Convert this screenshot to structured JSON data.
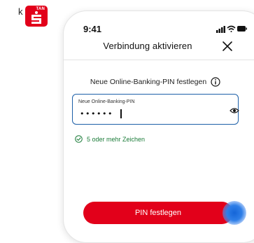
{
  "app_badge": {
    "text": "TAN",
    "icon": "sparkasse-s-logo"
  },
  "left_char": "k",
  "status_bar": {
    "time": "9:41",
    "icons": [
      "signal-icon",
      "wifi-icon",
      "battery-icon"
    ]
  },
  "header": {
    "title": "Verbindung aktivieren",
    "close_icon": "close-icon"
  },
  "prompt": {
    "text": "Neue Online-Banking-PIN festlegen",
    "info_icon": "info-icon"
  },
  "pin_field": {
    "label": "Neue Online-Banking-PIN",
    "value": "••••••",
    "toggle_icon": "eye-icon"
  },
  "validation": {
    "text": "5 oder mehr Zeichen",
    "icon": "check-circle-icon"
  },
  "primary_button": {
    "label": "PIN festlegen"
  },
  "colors": {
    "accent": "#e2001a",
    "focus": "#1c5fa8",
    "success": "#1c7c3a",
    "touch": "#1565d8"
  }
}
